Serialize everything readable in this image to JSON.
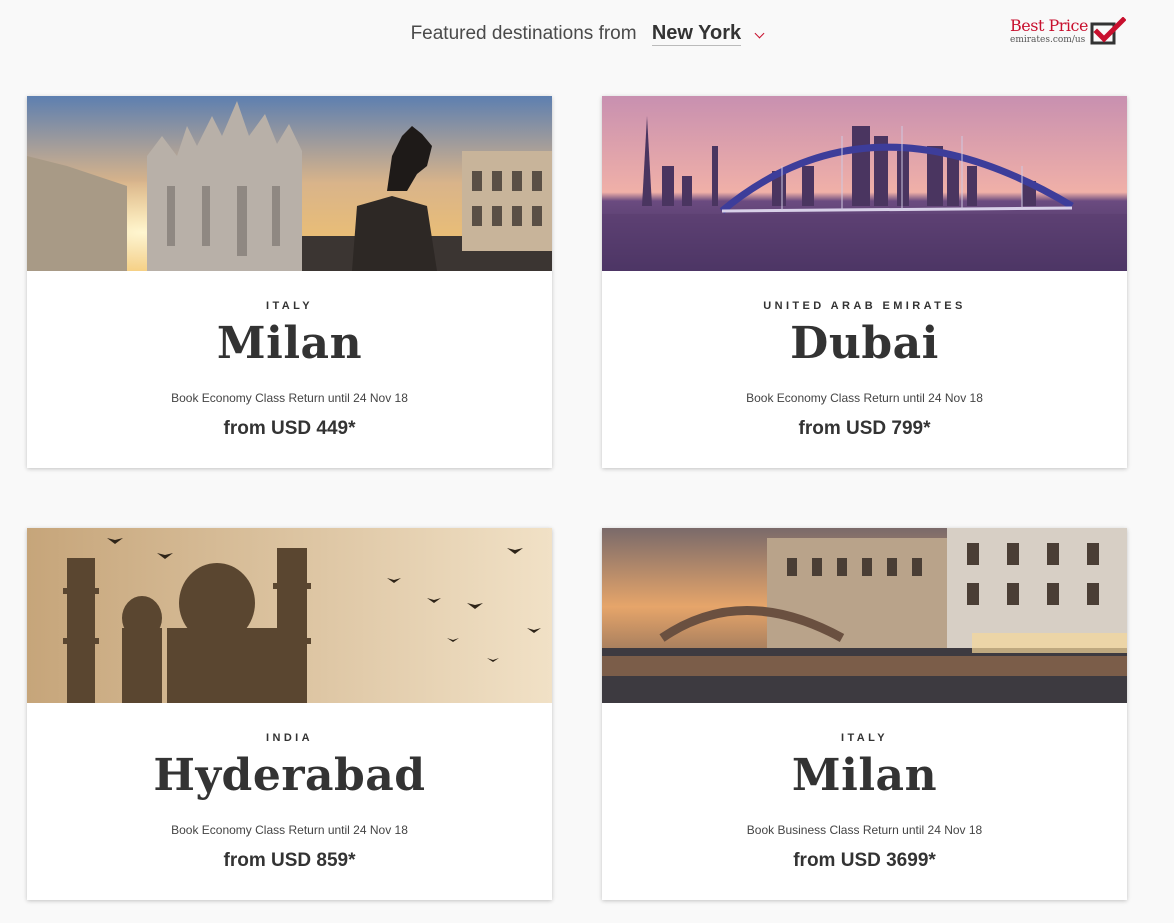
{
  "header": {
    "featured_label": "Featured destinations from",
    "origin_city": "New York",
    "best_price_title": "Best Price",
    "best_price_url": "emirates.com/us"
  },
  "colors": {
    "accent": "#c8102e",
    "text": "#333333",
    "background": "#f9f9f9"
  },
  "cards": [
    {
      "country": "ITALY",
      "destination": "Milan",
      "offer": "Book Economy Class Return until 24 Nov 18",
      "price": "from USD 449*"
    },
    {
      "country": "UNITED ARAB EMIRATES",
      "destination": "Dubai",
      "offer": "Book Economy Class Return until 24 Nov 18",
      "price": "from USD 799*"
    },
    {
      "country": "INDIA",
      "destination": "Hyderabad",
      "offer": "Book Economy Class Return until 24 Nov 18",
      "price": "from USD 859*"
    },
    {
      "country": "ITALY",
      "destination": "Milan",
      "offer": "Book Business Class Return until 24 Nov 18",
      "price": "from USD 3699*"
    }
  ]
}
